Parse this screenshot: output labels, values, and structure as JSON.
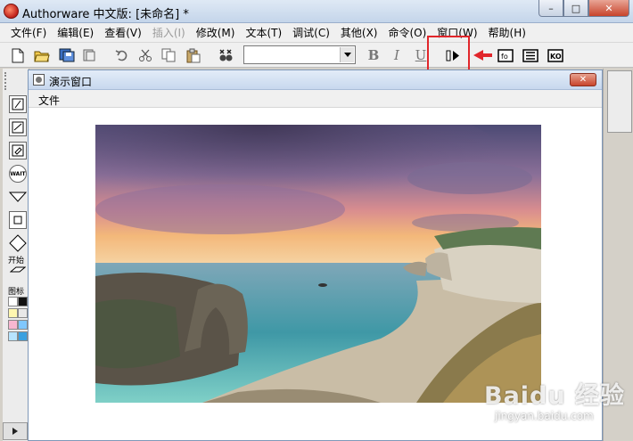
{
  "window": {
    "title": "Authorware 中文版: [未命名] *",
    "min_glyph": "–",
    "max_glyph": "□",
    "close_glyph": "✕"
  },
  "menu": [
    {
      "label": "文件(F)",
      "enabled": true
    },
    {
      "label": "编辑(E)",
      "enabled": true
    },
    {
      "label": "查看(V)",
      "enabled": true
    },
    {
      "label": "插入(I)",
      "enabled": false
    },
    {
      "label": "修改(M)",
      "enabled": true
    },
    {
      "label": "文本(T)",
      "enabled": true
    },
    {
      "label": "调试(C)",
      "enabled": true
    },
    {
      "label": "其他(X)",
      "enabled": true
    },
    {
      "label": "命令(O)",
      "enabled": true
    },
    {
      "label": "窗口(W)",
      "enabled": true
    },
    {
      "label": "帮助(H)",
      "enabled": true
    }
  ],
  "toolbar": {
    "font_value": "",
    "bold_label": "B",
    "italic_label": "I",
    "underline_label": "U"
  },
  "palette": {
    "wait_icon_text": "WAIT",
    "start_label": "开始",
    "icon_color_label": "图标"
  },
  "presentation": {
    "title": "演示窗口",
    "menu_file": "文件",
    "close_glyph": "✕"
  },
  "watermark": {
    "main": "Baidu 经验",
    "sub": "jingyan.baidu.com"
  },
  "colors": {
    "highlight": "#e1262b",
    "arrow": "#e1262b"
  }
}
